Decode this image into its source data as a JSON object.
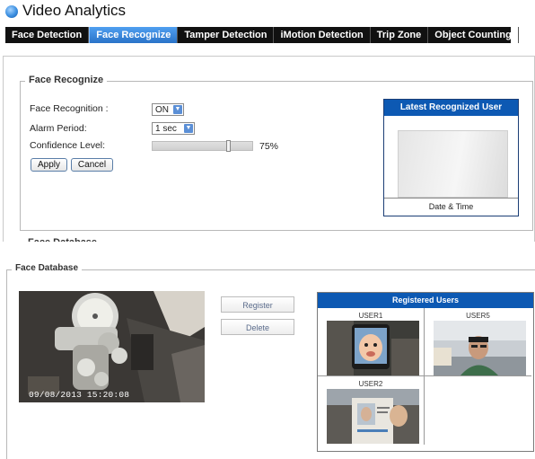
{
  "app": {
    "title": "Video Analytics",
    "logo_icon": "globe-logo-icon"
  },
  "tabs": [
    {
      "label": "Face Detection",
      "active": false
    },
    {
      "label": "Face Recognize",
      "active": true
    },
    {
      "label": "Tamper Detection",
      "active": false
    },
    {
      "label": "iMotion Detection",
      "active": false
    },
    {
      "label": "Trip Zone",
      "active": false
    },
    {
      "label": "Object Counting",
      "active": false
    }
  ],
  "face_recognize": {
    "legend": "Face Recognize",
    "face_recognition_label": "Face Recognition :",
    "face_recognition_value": "ON",
    "alarm_period_label": "Alarm Period:",
    "alarm_period_value": "1 sec",
    "confidence_label": "Confidence Level:",
    "confidence_value": "75%",
    "confidence_fraction": 0.75,
    "apply_label": "Apply",
    "cancel_label": "Cancel"
  },
  "latest_user": {
    "title": "Latest Recognized User",
    "footer": "Date & Time"
  },
  "cut_label": "Face Database",
  "face_database": {
    "legend": "Face Database",
    "video_timestamp": "09/08/2013   15:20:08",
    "register_label": "Register",
    "delete_label": "Delete",
    "registered_title": "Registered Users",
    "users": [
      {
        "name": "USER1"
      },
      {
        "name": "USER5"
      },
      {
        "name": "USER2"
      }
    ]
  },
  "colors": {
    "accent_blue": "#0d59b3",
    "tab_bar": "#111111",
    "active_tab": "#2a73c8"
  }
}
